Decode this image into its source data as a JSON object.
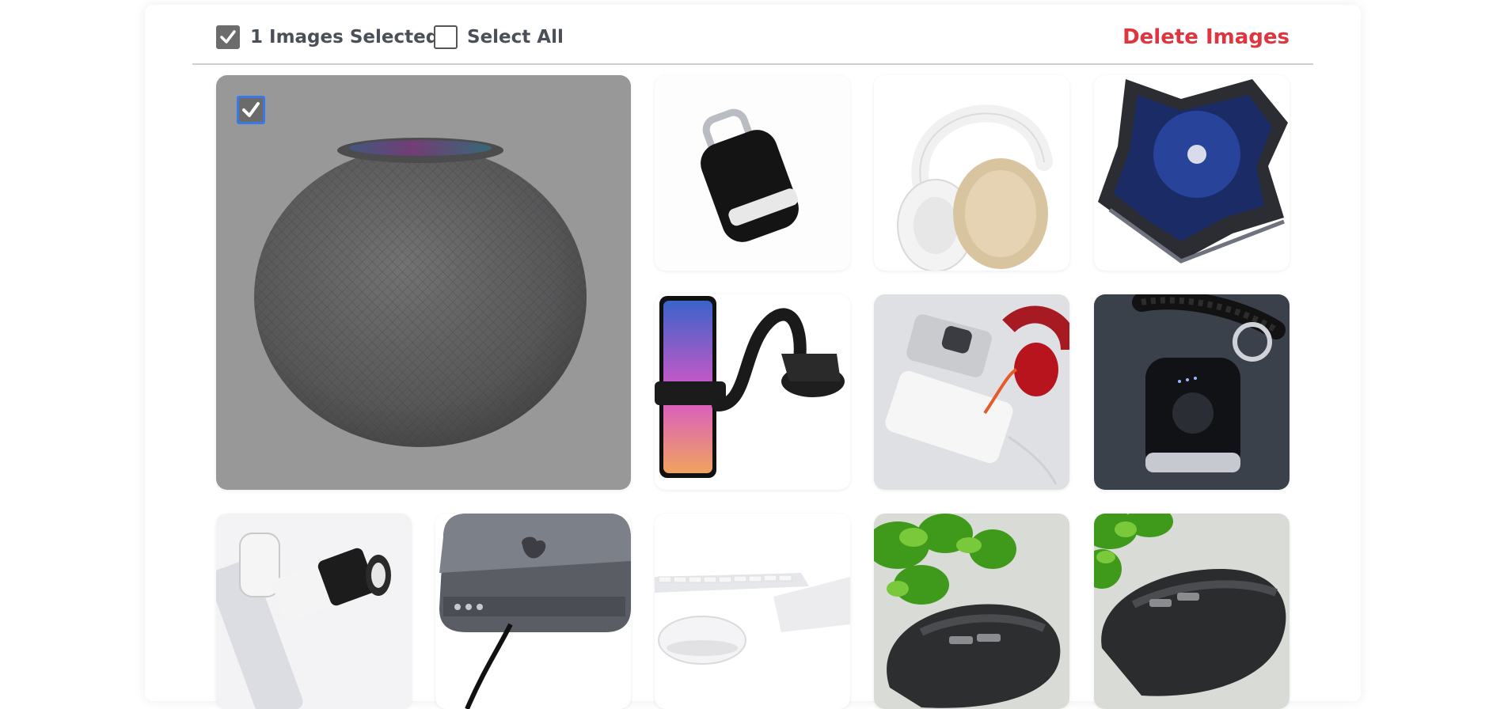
{
  "header": {
    "selected_count_label": "1 Images Selected",
    "select_all_label": "Select All",
    "delete_label": "Delete Images",
    "selected_checkbox_checked": true,
    "select_all_checked": false
  },
  "colors": {
    "delete": "#e0343e",
    "checkbox_fill": "#6c6c6c",
    "focus_ring": "#3b78e7",
    "text": "#4a4f58"
  },
  "gallery": {
    "images": [
      {
        "name": "smart-speaker",
        "selected": true,
        "featured": true
      },
      {
        "name": "keychain-charger",
        "selected": false
      },
      {
        "name": "headphones",
        "selected": false
      },
      {
        "name": "laptop-cooling-pad",
        "selected": false
      },
      {
        "name": "car-phone-mount",
        "selected": false
      },
      {
        "name": "power-bank-with-headphones",
        "selected": false
      },
      {
        "name": "keychain-power-bank",
        "selected": false
      },
      {
        "name": "phone-telephoto-lens",
        "selected": false
      },
      {
        "name": "mac-mini-dock",
        "selected": false
      },
      {
        "name": "keyboard-mouse-trackpad",
        "selected": false
      },
      {
        "name": "wireless-mouse-1",
        "selected": false
      },
      {
        "name": "wireless-mouse-2",
        "selected": false
      }
    ]
  }
}
